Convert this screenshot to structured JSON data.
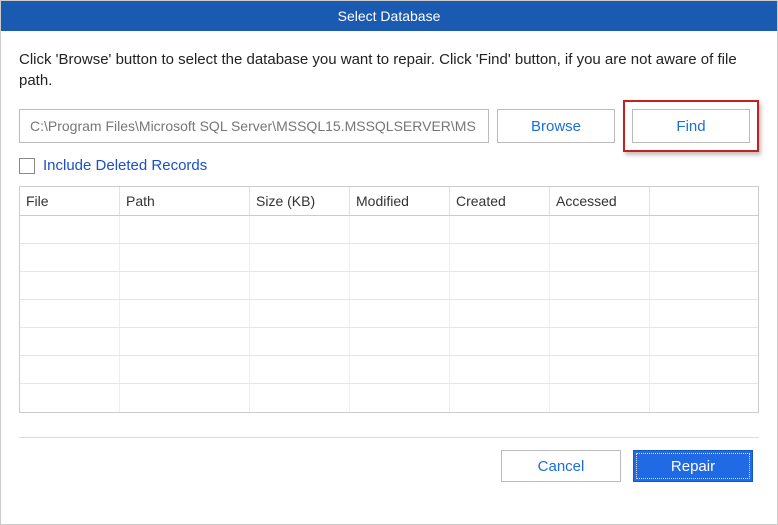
{
  "window": {
    "title": "Select Database"
  },
  "instructions": "Click 'Browse' button to select the database you want to repair. Click 'Find' button, if you are not aware of file path.",
  "path_input": {
    "value": "C:\\Program Files\\Microsoft SQL Server\\MSSQL15.MSSQLSERVER\\MS"
  },
  "buttons": {
    "browse": "Browse",
    "find": "Find",
    "cancel": "Cancel",
    "repair": "Repair"
  },
  "checkbox": {
    "include_deleted_label": "Include Deleted Records",
    "checked": false
  },
  "table": {
    "headers": {
      "file": "File",
      "path": "Path",
      "size": "Size (KB)",
      "modified": "Modified",
      "created": "Created",
      "accessed": "Accessed"
    },
    "rows": []
  }
}
